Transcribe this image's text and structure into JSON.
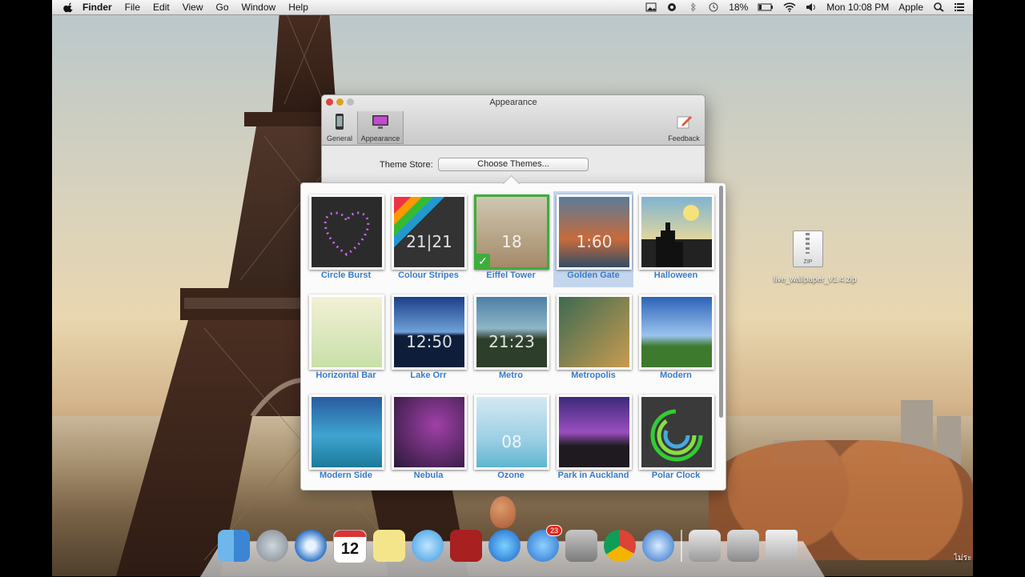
{
  "menubar": {
    "app": "Finder",
    "items": [
      "File",
      "Edit",
      "View",
      "Go",
      "Window",
      "Help"
    ],
    "battery": "18%",
    "clock": "Mon 10:08 PM",
    "user": "Apple"
  },
  "window": {
    "title": "Appearance",
    "toolbar": {
      "general": "General",
      "appearance": "Appearance",
      "feedback": "Feedback"
    },
    "theme_store_label": "Theme Store:",
    "choose_themes_button": "Choose Themes..."
  },
  "themes": [
    {
      "name": "Circle Burst",
      "thumb": "1",
      "selected": false,
      "active": false
    },
    {
      "name": "Colour Stripes",
      "thumb": "2",
      "selected": false,
      "active": false
    },
    {
      "name": "Eiffel Tower",
      "thumb": "3",
      "selected": false,
      "active": true
    },
    {
      "name": "Golden Gate",
      "thumb": "4",
      "selected": true,
      "active": false
    },
    {
      "name": "Halloween",
      "thumb": "5",
      "selected": false,
      "active": false
    },
    {
      "name": "Horizontal Bar",
      "thumb": "6",
      "selected": false,
      "active": false
    },
    {
      "name": "Lake Orr",
      "thumb": "7",
      "selected": false,
      "active": false
    },
    {
      "name": "Metro",
      "thumb": "8",
      "selected": false,
      "active": false
    },
    {
      "name": "Metropolis",
      "thumb": "9",
      "selected": false,
      "active": false
    },
    {
      "name": "Modern",
      "thumb": "10",
      "selected": false,
      "active": false
    },
    {
      "name": "Modern Side",
      "thumb": "11",
      "selected": false,
      "active": false
    },
    {
      "name": "Nebula",
      "thumb": "12",
      "selected": false,
      "active": false
    },
    {
      "name": "Ozone",
      "thumb": "13",
      "selected": false,
      "active": false
    },
    {
      "name": "Park in Auckland",
      "thumb": "14",
      "selected": false,
      "active": false
    },
    {
      "name": "Polar Clock",
      "thumb": "15",
      "selected": false,
      "active": false
    }
  ],
  "desktop": {
    "file_label": "live_wallpaper_v1.4.zip",
    "file_type": "ZIP",
    "right_edge_label": "ไม่ระ folde"
  },
  "dock": {
    "calendar_day": "12",
    "appstore_badge": "23"
  },
  "colors": {
    "selection": "#c4d6ee",
    "active_check": "#3dad3d",
    "label_blue": "#3a7bc8"
  }
}
